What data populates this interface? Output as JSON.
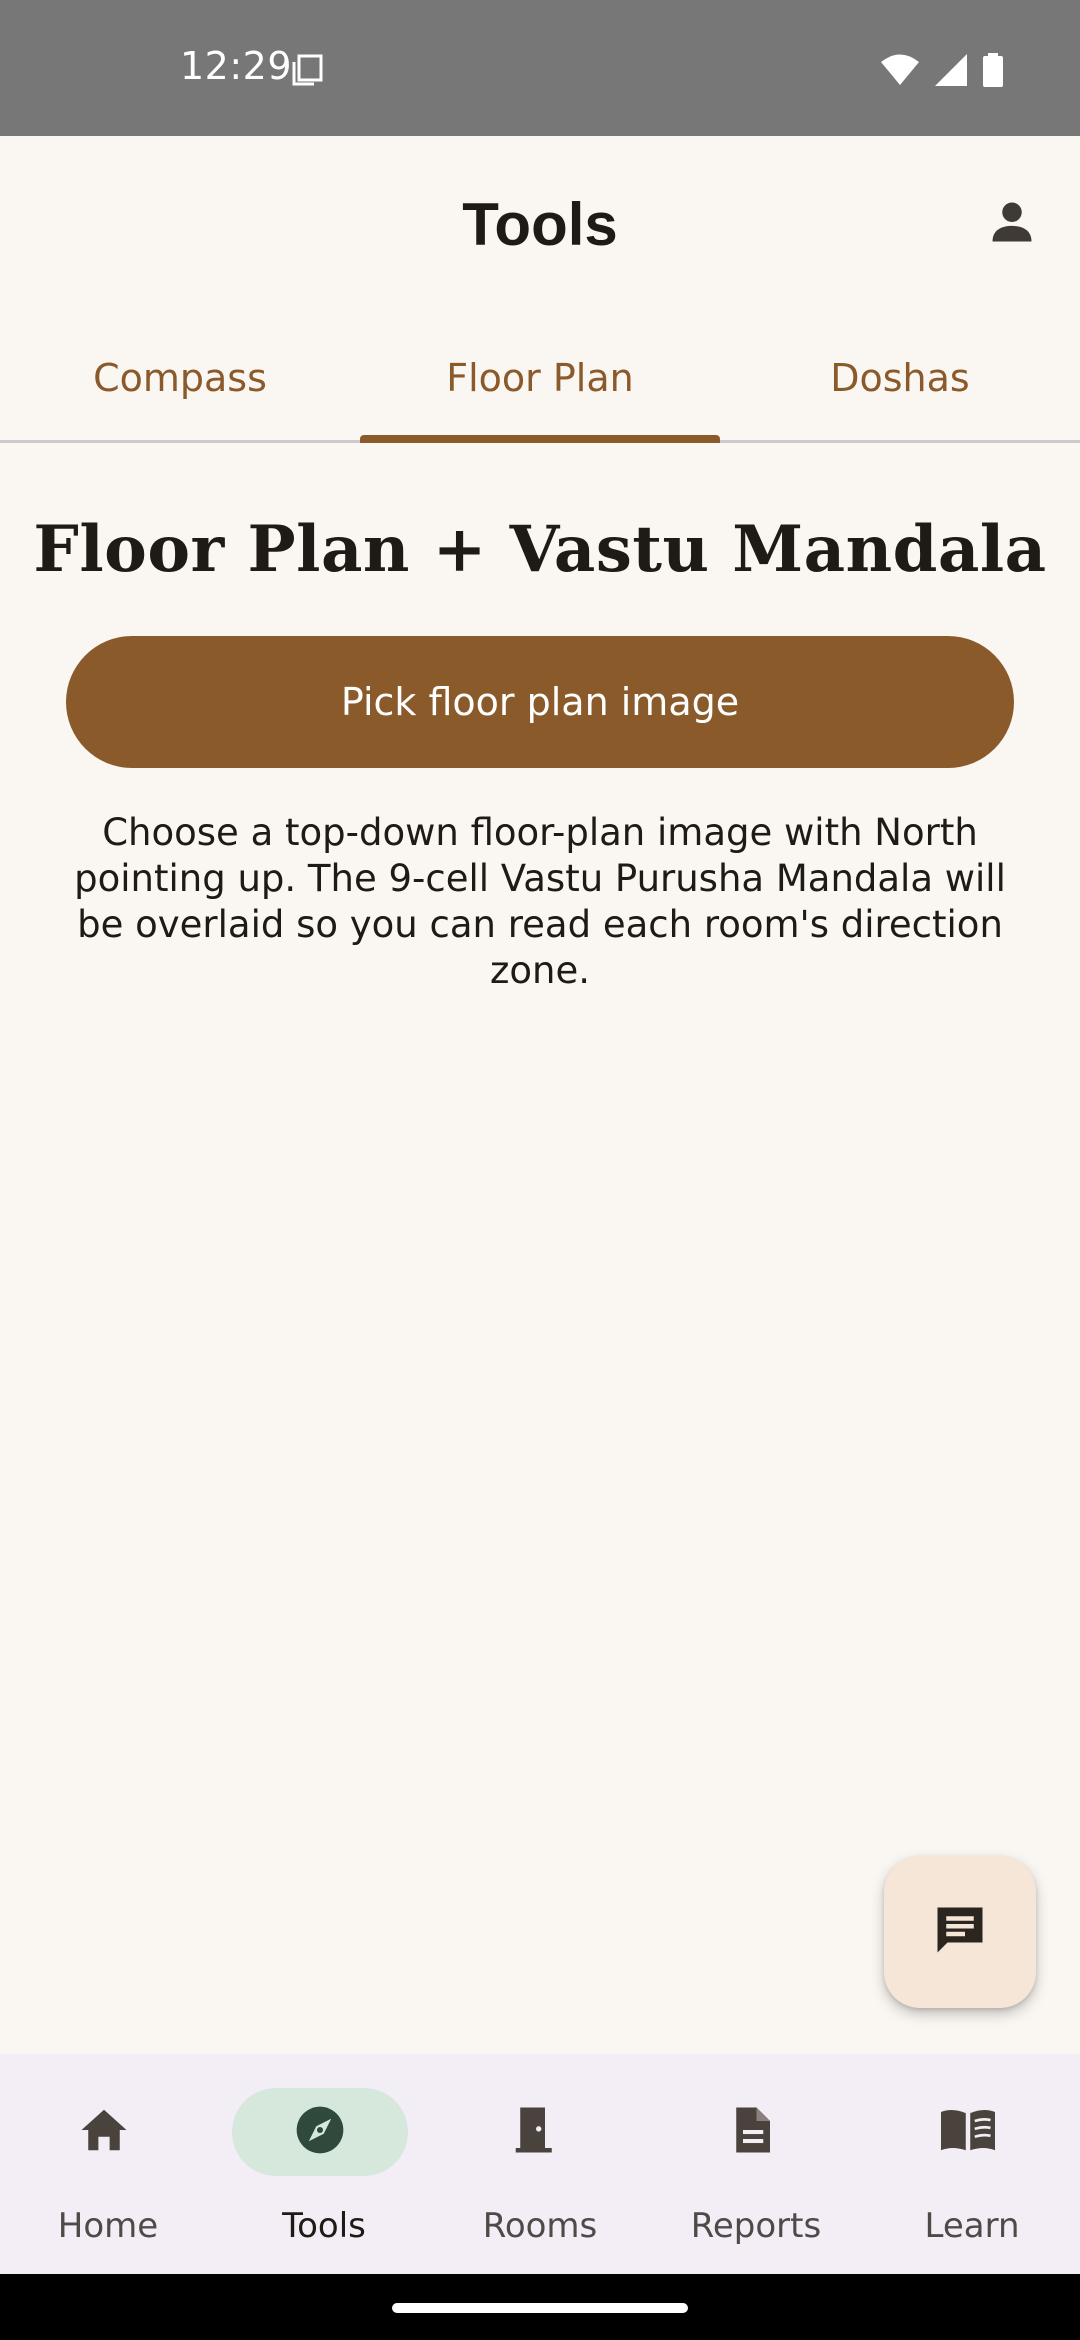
{
  "status_bar": {
    "time": "12:29",
    "icons": [
      "doc-icon",
      "wifi-icon",
      "signal-icon",
      "battery-icon"
    ]
  },
  "app_bar": {
    "title": "Tools",
    "profile_icon": "person-icon"
  },
  "tabs": [
    {
      "label": "Compass",
      "selected": false
    },
    {
      "label": "Floor Plan",
      "selected": true
    },
    {
      "label": "Doshas",
      "selected": false
    }
  ],
  "content": {
    "title": "Floor Plan + Vastu Mandala",
    "pick_button_label": "Pick floor plan image",
    "description": "Choose a top-down floor-plan image with North pointing up. The 9-cell Vastu Purusha Mandala will be overlaid so you can read each room's direction zone."
  },
  "fab": {
    "icon": "chat-icon"
  },
  "bottom_nav": [
    {
      "label": "Home",
      "icon": "home-icon",
      "active": false
    },
    {
      "label": "Tools",
      "icon": "compass-icon",
      "active": true
    },
    {
      "label": "Rooms",
      "icon": "door-icon",
      "active": false
    },
    {
      "label": "Reports",
      "icon": "document-icon",
      "active": false
    },
    {
      "label": "Learn",
      "icon": "book-icon",
      "active": false
    }
  ],
  "colors": {
    "accent": "#8b5a2b",
    "background": "#faf6f2",
    "nav_background": "#f3edf6",
    "nav_active_pill": "#d6e8dc",
    "fab_background": "#f6e6d8"
  }
}
